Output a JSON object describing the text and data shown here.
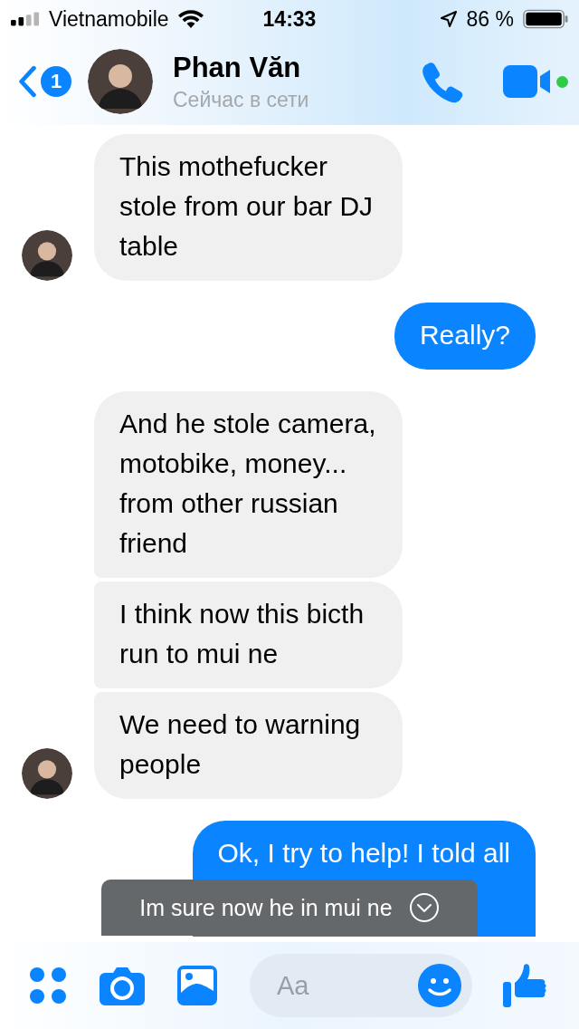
{
  "status_bar": {
    "carrier": "Vietnamobile",
    "time": "14:33",
    "battery": "86 %"
  },
  "header": {
    "back_badge": "1",
    "name": "Phan Văn",
    "status": "Сейчас в сети",
    "online": true
  },
  "messages": [
    {
      "outgoing": false,
      "text": "This mothefucker stole from our bar DJ table",
      "avatar": true
    },
    {
      "outgoing": true,
      "text": "Really?"
    },
    {
      "outgoing": false,
      "text": "And he stole camera, motobike, money... from other russian friend",
      "avatar": false
    },
    {
      "outgoing": false,
      "text": "I think now this bicth run to mui ne",
      "avatar": false
    },
    {
      "outgoing": false,
      "text": "We need to warning people",
      "avatar": true
    },
    {
      "outgoing": true,
      "text": "Ok, I try to help! I told all"
    }
  ],
  "toast": {
    "text": "Im sure now he in mui ne"
  },
  "composer": {
    "placeholder": "Aa"
  }
}
